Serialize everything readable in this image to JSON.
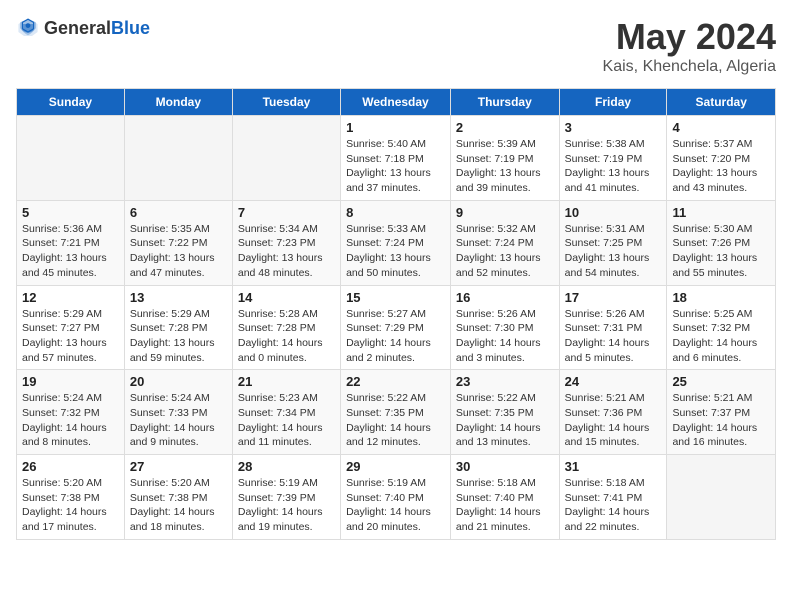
{
  "header": {
    "logo_general": "General",
    "logo_blue": "Blue",
    "title": "May 2024",
    "subtitle": "Kais, Khenchela, Algeria"
  },
  "weekdays": [
    "Sunday",
    "Monday",
    "Tuesday",
    "Wednesday",
    "Thursday",
    "Friday",
    "Saturday"
  ],
  "weeks": [
    [
      {
        "day": "",
        "sunrise": "",
        "sunset": "",
        "daylight": "",
        "empty": true
      },
      {
        "day": "",
        "sunrise": "",
        "sunset": "",
        "daylight": "",
        "empty": true
      },
      {
        "day": "",
        "sunrise": "",
        "sunset": "",
        "daylight": "",
        "empty": true
      },
      {
        "day": "1",
        "sunrise": "Sunrise: 5:40 AM",
        "sunset": "Sunset: 7:18 PM",
        "daylight": "Daylight: 13 hours and 37 minutes."
      },
      {
        "day": "2",
        "sunrise": "Sunrise: 5:39 AM",
        "sunset": "Sunset: 7:19 PM",
        "daylight": "Daylight: 13 hours and 39 minutes."
      },
      {
        "day": "3",
        "sunrise": "Sunrise: 5:38 AM",
        "sunset": "Sunset: 7:19 PM",
        "daylight": "Daylight: 13 hours and 41 minutes."
      },
      {
        "day": "4",
        "sunrise": "Sunrise: 5:37 AM",
        "sunset": "Sunset: 7:20 PM",
        "daylight": "Daylight: 13 hours and 43 minutes."
      }
    ],
    [
      {
        "day": "5",
        "sunrise": "Sunrise: 5:36 AM",
        "sunset": "Sunset: 7:21 PM",
        "daylight": "Daylight: 13 hours and 45 minutes."
      },
      {
        "day": "6",
        "sunrise": "Sunrise: 5:35 AM",
        "sunset": "Sunset: 7:22 PM",
        "daylight": "Daylight: 13 hours and 47 minutes."
      },
      {
        "day": "7",
        "sunrise": "Sunrise: 5:34 AM",
        "sunset": "Sunset: 7:23 PM",
        "daylight": "Daylight: 13 hours and 48 minutes."
      },
      {
        "day": "8",
        "sunrise": "Sunrise: 5:33 AM",
        "sunset": "Sunset: 7:24 PM",
        "daylight": "Daylight: 13 hours and 50 minutes."
      },
      {
        "day": "9",
        "sunrise": "Sunrise: 5:32 AM",
        "sunset": "Sunset: 7:24 PM",
        "daylight": "Daylight: 13 hours and 52 minutes."
      },
      {
        "day": "10",
        "sunrise": "Sunrise: 5:31 AM",
        "sunset": "Sunset: 7:25 PM",
        "daylight": "Daylight: 13 hours and 54 minutes."
      },
      {
        "day": "11",
        "sunrise": "Sunrise: 5:30 AM",
        "sunset": "Sunset: 7:26 PM",
        "daylight": "Daylight: 13 hours and 55 minutes."
      }
    ],
    [
      {
        "day": "12",
        "sunrise": "Sunrise: 5:29 AM",
        "sunset": "Sunset: 7:27 PM",
        "daylight": "Daylight: 13 hours and 57 minutes."
      },
      {
        "day": "13",
        "sunrise": "Sunrise: 5:29 AM",
        "sunset": "Sunset: 7:28 PM",
        "daylight": "Daylight: 13 hours and 59 minutes."
      },
      {
        "day": "14",
        "sunrise": "Sunrise: 5:28 AM",
        "sunset": "Sunset: 7:28 PM",
        "daylight": "Daylight: 14 hours and 0 minutes."
      },
      {
        "day": "15",
        "sunrise": "Sunrise: 5:27 AM",
        "sunset": "Sunset: 7:29 PM",
        "daylight": "Daylight: 14 hours and 2 minutes."
      },
      {
        "day": "16",
        "sunrise": "Sunrise: 5:26 AM",
        "sunset": "Sunset: 7:30 PM",
        "daylight": "Daylight: 14 hours and 3 minutes."
      },
      {
        "day": "17",
        "sunrise": "Sunrise: 5:26 AM",
        "sunset": "Sunset: 7:31 PM",
        "daylight": "Daylight: 14 hours and 5 minutes."
      },
      {
        "day": "18",
        "sunrise": "Sunrise: 5:25 AM",
        "sunset": "Sunset: 7:32 PM",
        "daylight": "Daylight: 14 hours and 6 minutes."
      }
    ],
    [
      {
        "day": "19",
        "sunrise": "Sunrise: 5:24 AM",
        "sunset": "Sunset: 7:32 PM",
        "daylight": "Daylight: 14 hours and 8 minutes."
      },
      {
        "day": "20",
        "sunrise": "Sunrise: 5:24 AM",
        "sunset": "Sunset: 7:33 PM",
        "daylight": "Daylight: 14 hours and 9 minutes."
      },
      {
        "day": "21",
        "sunrise": "Sunrise: 5:23 AM",
        "sunset": "Sunset: 7:34 PM",
        "daylight": "Daylight: 14 hours and 11 minutes."
      },
      {
        "day": "22",
        "sunrise": "Sunrise: 5:22 AM",
        "sunset": "Sunset: 7:35 PM",
        "daylight": "Daylight: 14 hours and 12 minutes."
      },
      {
        "day": "23",
        "sunrise": "Sunrise: 5:22 AM",
        "sunset": "Sunset: 7:35 PM",
        "daylight": "Daylight: 14 hours and 13 minutes."
      },
      {
        "day": "24",
        "sunrise": "Sunrise: 5:21 AM",
        "sunset": "Sunset: 7:36 PM",
        "daylight": "Daylight: 14 hours and 15 minutes."
      },
      {
        "day": "25",
        "sunrise": "Sunrise: 5:21 AM",
        "sunset": "Sunset: 7:37 PM",
        "daylight": "Daylight: 14 hours and 16 minutes."
      }
    ],
    [
      {
        "day": "26",
        "sunrise": "Sunrise: 5:20 AM",
        "sunset": "Sunset: 7:38 PM",
        "daylight": "Daylight: 14 hours and 17 minutes."
      },
      {
        "day": "27",
        "sunrise": "Sunrise: 5:20 AM",
        "sunset": "Sunset: 7:38 PM",
        "daylight": "Daylight: 14 hours and 18 minutes."
      },
      {
        "day": "28",
        "sunrise": "Sunrise: 5:19 AM",
        "sunset": "Sunset: 7:39 PM",
        "daylight": "Daylight: 14 hours and 19 minutes."
      },
      {
        "day": "29",
        "sunrise": "Sunrise: 5:19 AM",
        "sunset": "Sunset: 7:40 PM",
        "daylight": "Daylight: 14 hours and 20 minutes."
      },
      {
        "day": "30",
        "sunrise": "Sunrise: 5:18 AM",
        "sunset": "Sunset: 7:40 PM",
        "daylight": "Daylight: 14 hours and 21 minutes."
      },
      {
        "day": "31",
        "sunrise": "Sunrise: 5:18 AM",
        "sunset": "Sunset: 7:41 PM",
        "daylight": "Daylight: 14 hours and 22 minutes."
      },
      {
        "day": "",
        "sunrise": "",
        "sunset": "",
        "daylight": "",
        "empty": true
      }
    ]
  ]
}
